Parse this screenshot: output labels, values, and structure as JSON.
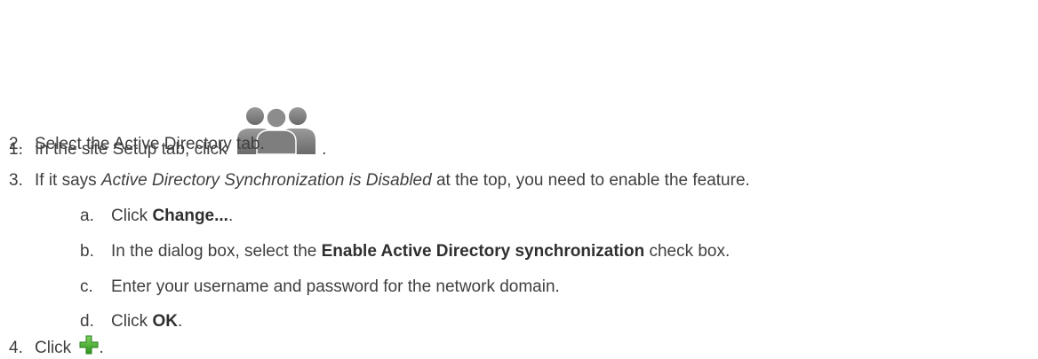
{
  "steps": [
    {
      "number": "1.",
      "text_before": "In the site Setup tab, click",
      "icon": "users-group-icon",
      "text_after": "."
    },
    {
      "number": "2.",
      "text": "Select the Active Directory tab."
    },
    {
      "number": "3.",
      "text_italic": "Active Directory Synchronization is Disabled",
      "text_before": "If it says",
      "text_after": "at the top, you need to enable the feature.",
      "substeps": [
        {
          "letter": "a.",
          "text_before": "Click",
          "bold": "Change...",
          "text_after": "."
        },
        {
          "letter": "b.",
          "text_before": "In the dialog box, select the",
          "bold": "Enable Active Directory synchronization",
          "text_after": "check box."
        },
        {
          "letter": "c.",
          "text": "Enter your username and password for the network domain."
        },
        {
          "letter": "d.",
          "text_before": "Click",
          "bold": "OK",
          "text_after": "."
        }
      ]
    },
    {
      "number": "4.",
      "text_before": "Click",
      "icon": "green-plus-icon",
      "text_after": "."
    }
  ],
  "colors": {
    "text": "#3f3f3f",
    "icon_gray": "#7a7a7a",
    "plus_green": "#3aa52a"
  }
}
